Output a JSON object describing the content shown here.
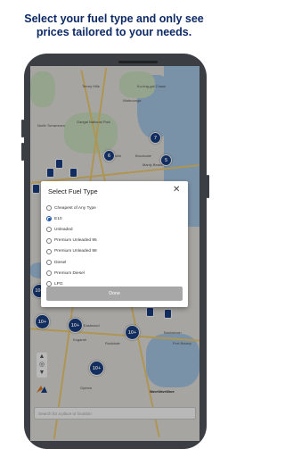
{
  "headline": {
    "line1": "Select your fuel type and only see",
    "line2": "prices tailored to your needs."
  },
  "map": {
    "labels": [
      "Terrey Hills",
      "Wahroonga",
      "North Turramurra",
      "Garigal National Park",
      "Forestville",
      "Brookvale",
      "Manly Beach",
      "Rockdale",
      "Eastwood",
      "Kogarah",
      "Bankstown",
      "Port Botany",
      "Gymea",
      "Ku-ring-gai Chase"
    ],
    "clusters": [
      "7",
      "6",
      "5",
      "10+",
      "10+",
      "10+",
      "10+",
      "10+"
    ],
    "attribution": "WaveWaveWave",
    "search_placeholder": "Search for a place or location"
  },
  "dialog": {
    "title": "Select Fuel Type",
    "close_glyph": "✕",
    "options": [
      {
        "label": "Cheapest of Any Type",
        "selected": false
      },
      {
        "label": "E10",
        "selected": true
      },
      {
        "label": "Unleaded",
        "selected": false
      },
      {
        "label": "Premium Unleaded 95",
        "selected": false
      },
      {
        "label": "Premium Unleaded 98",
        "selected": false
      },
      {
        "label": "Diesel",
        "selected": false
      },
      {
        "label": "Premium Diesel",
        "selected": false
      },
      {
        "label": "LPG",
        "selected": false
      }
    ],
    "done_label": "Done"
  },
  "colors": {
    "headline": "#0d2a66",
    "cluster": "#1a3f86",
    "radio_selected": "#1e5aa8",
    "done_button": "#a7a7a7"
  }
}
